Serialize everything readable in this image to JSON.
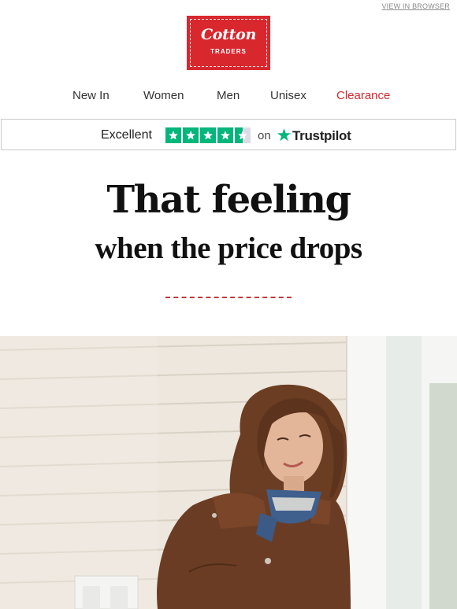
{
  "header": {
    "view_in_browser": "VIEW IN BROWSER",
    "logo": {
      "script": "Cotton",
      "sub": "TRADERS",
      "brand_color": "#d9272e"
    }
  },
  "nav": {
    "items": [
      {
        "label": "New In"
      },
      {
        "label": "Women"
      },
      {
        "label": "Men"
      },
      {
        "label": "Unisex"
      },
      {
        "label": "Clearance",
        "accent": "#d9272e"
      }
    ]
  },
  "trustpilot": {
    "rating_word": "Excellent",
    "stars": 4.5,
    "star_color": "#00b67a",
    "on": "on",
    "brand": "Trustpilot"
  },
  "hero_text": {
    "headline": "That feeling",
    "subhead": "when the price drops",
    "divider_color": "#c0393b"
  },
  "hero_image": {
    "subject": "woman-in-brown-jacket-icon"
  }
}
